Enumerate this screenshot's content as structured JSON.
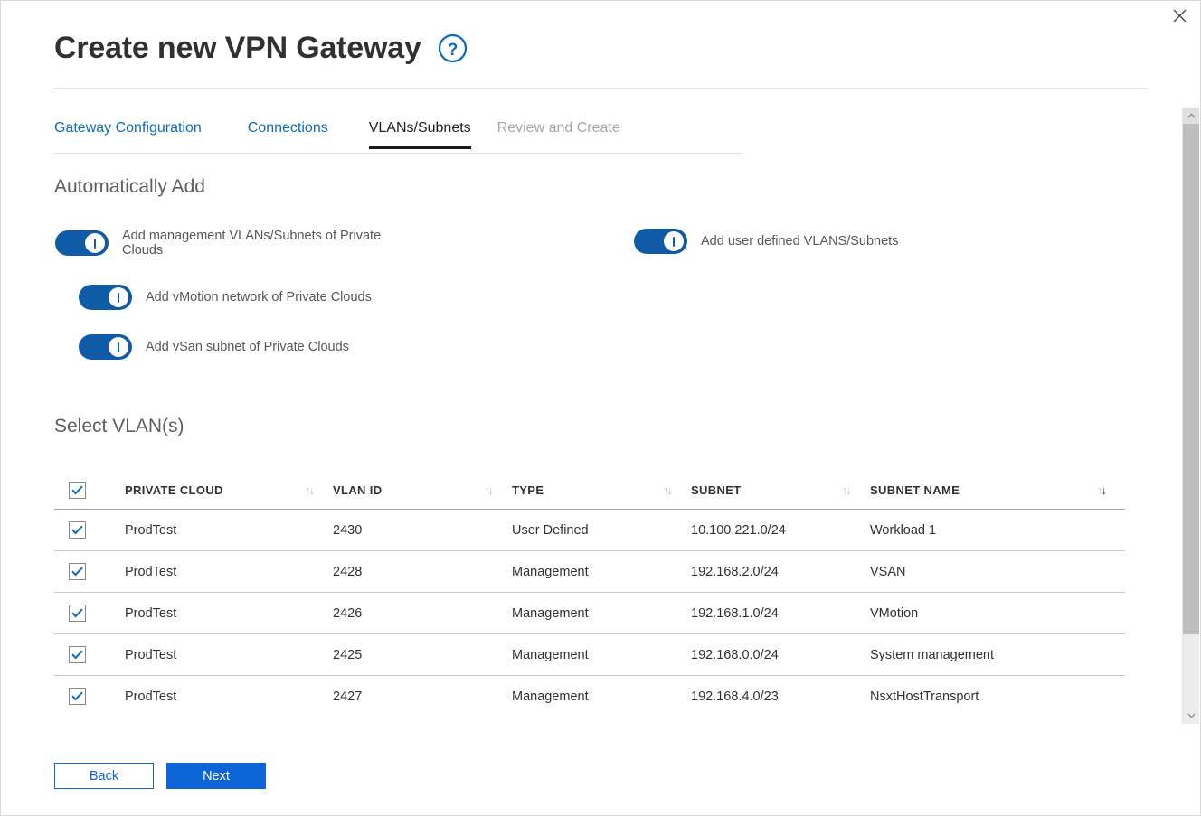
{
  "window": {
    "close_label": "×"
  },
  "header": {
    "title": "Create new VPN Gateway",
    "help_icon": "question-circle-icon"
  },
  "tabs": [
    {
      "label": "Gateway Configuration",
      "state": "link"
    },
    {
      "label": "Connections",
      "state": "link"
    },
    {
      "label": "VLANs/Subnets",
      "state": "active"
    },
    {
      "label": "Review and Create",
      "state": "disabled"
    }
  ],
  "auto_add": {
    "heading": "Automatically Add",
    "toggles": [
      {
        "label": "Add management VLANs/Subnets of Private Clouds",
        "on": true
      },
      {
        "label": "Add user defined VLANS/Subnets",
        "on": true
      },
      {
        "label": "Add vMotion network of Private Clouds",
        "on": true
      },
      {
        "label": "Add vSan subnet of Private Clouds",
        "on": true
      }
    ]
  },
  "select_vlans": {
    "heading": "Select VLAN(s)",
    "select_all_checked": true,
    "columns": [
      {
        "label": "PRIVATE CLOUD",
        "sort": "none"
      },
      {
        "label": "VLAN ID",
        "sort": "none"
      },
      {
        "label": "TYPE",
        "sort": "none"
      },
      {
        "label": "SUBNET",
        "sort": "none"
      },
      {
        "label": "SUBNET NAME",
        "sort": "desc"
      }
    ],
    "rows": [
      {
        "checked": true,
        "private_cloud": "ProdTest",
        "vlan_id": "2430",
        "type": "User Defined",
        "subnet": "10.100.221.0/24",
        "subnet_name": "Workload 1"
      },
      {
        "checked": true,
        "private_cloud": "ProdTest",
        "vlan_id": "2428",
        "type": "Management",
        "subnet": "192.168.2.0/24",
        "subnet_name": "VSAN"
      },
      {
        "checked": true,
        "private_cloud": "ProdTest",
        "vlan_id": "2426",
        "type": "Management",
        "subnet": "192.168.1.0/24",
        "subnet_name": "VMotion"
      },
      {
        "checked": true,
        "private_cloud": "ProdTest",
        "vlan_id": "2425",
        "type": "Management",
        "subnet": "192.168.0.0/24",
        "subnet_name": "System management"
      },
      {
        "checked": true,
        "private_cloud": "ProdTest",
        "vlan_id": "2427",
        "type": "Management",
        "subnet": "192.168.4.0/23",
        "subnet_name": "NsxtHostTransport"
      }
    ]
  },
  "footer": {
    "back_label": "Back",
    "next_label": "Next"
  },
  "colors": {
    "toggle_on": "#0f5ba8",
    "primary_button": "#0c64d6",
    "tab_link": "#0f6cbd",
    "tab_active": "#201f1e",
    "tab_disabled": "#a6a6a6",
    "checkbox_check": "#0f6cbd"
  },
  "scrollbar": {
    "up_icon": "chevron-up-icon",
    "down_icon": "chevron-down-icon"
  }
}
